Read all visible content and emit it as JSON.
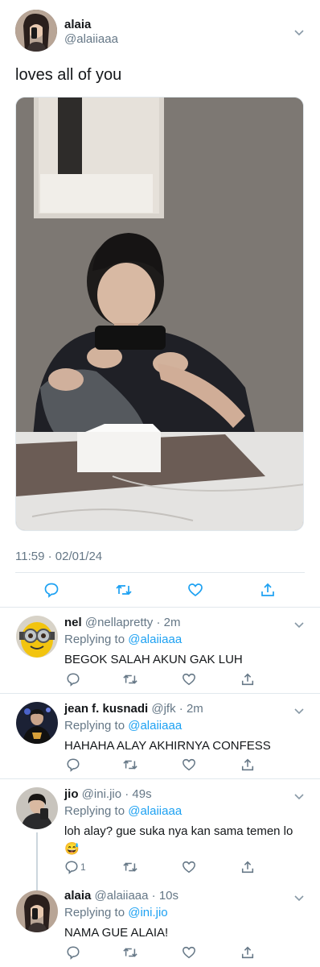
{
  "main_tweet": {
    "name": "alaia",
    "handle": "@alaiiaaa",
    "text": "loves all of you",
    "timestamp": "11:59 · 02/01/24"
  },
  "replies": [
    {
      "name": "nel",
      "handle": "@nellapretty",
      "time": "· 2m",
      "replying_prefix": "Replying to ",
      "replying_to": "@alaiiaaa",
      "text": "BEGOK SALAH AKUN GAK LUH",
      "reply_count": ""
    },
    {
      "name": "jean f. kusnadi",
      "handle": "@jfk",
      "time": "· 2m",
      "replying_prefix": "Replying to ",
      "replying_to": "@alaiiaaa",
      "text": "HAHAHA ALAY AKHIRNYA CONFESS",
      "reply_count": ""
    },
    {
      "name": "jio",
      "handle": "@ini.jio",
      "time": "· 49s",
      "replying_prefix": "Replying to ",
      "replying_to": "@alaiiaaa",
      "text": "loh alay? gue suka nya kan sama temen lo",
      "emoji": "😅",
      "reply_count": "1"
    },
    {
      "name": "alaia",
      "handle": "@alaiiaaa",
      "time": "· 10s",
      "replying_prefix": "Replying to ",
      "replying_to": "@ini.jio",
      "text": "NAMA GUE ALAIA!",
      "reply_count": ""
    }
  ],
  "colors": {
    "text": "#14171a",
    "muted": "#657786",
    "link": "#1da1f2",
    "divider": "#e1e8ed"
  },
  "icons": [
    "chevron-down-icon",
    "reply-icon",
    "retweet-icon",
    "like-icon",
    "share-icon"
  ]
}
